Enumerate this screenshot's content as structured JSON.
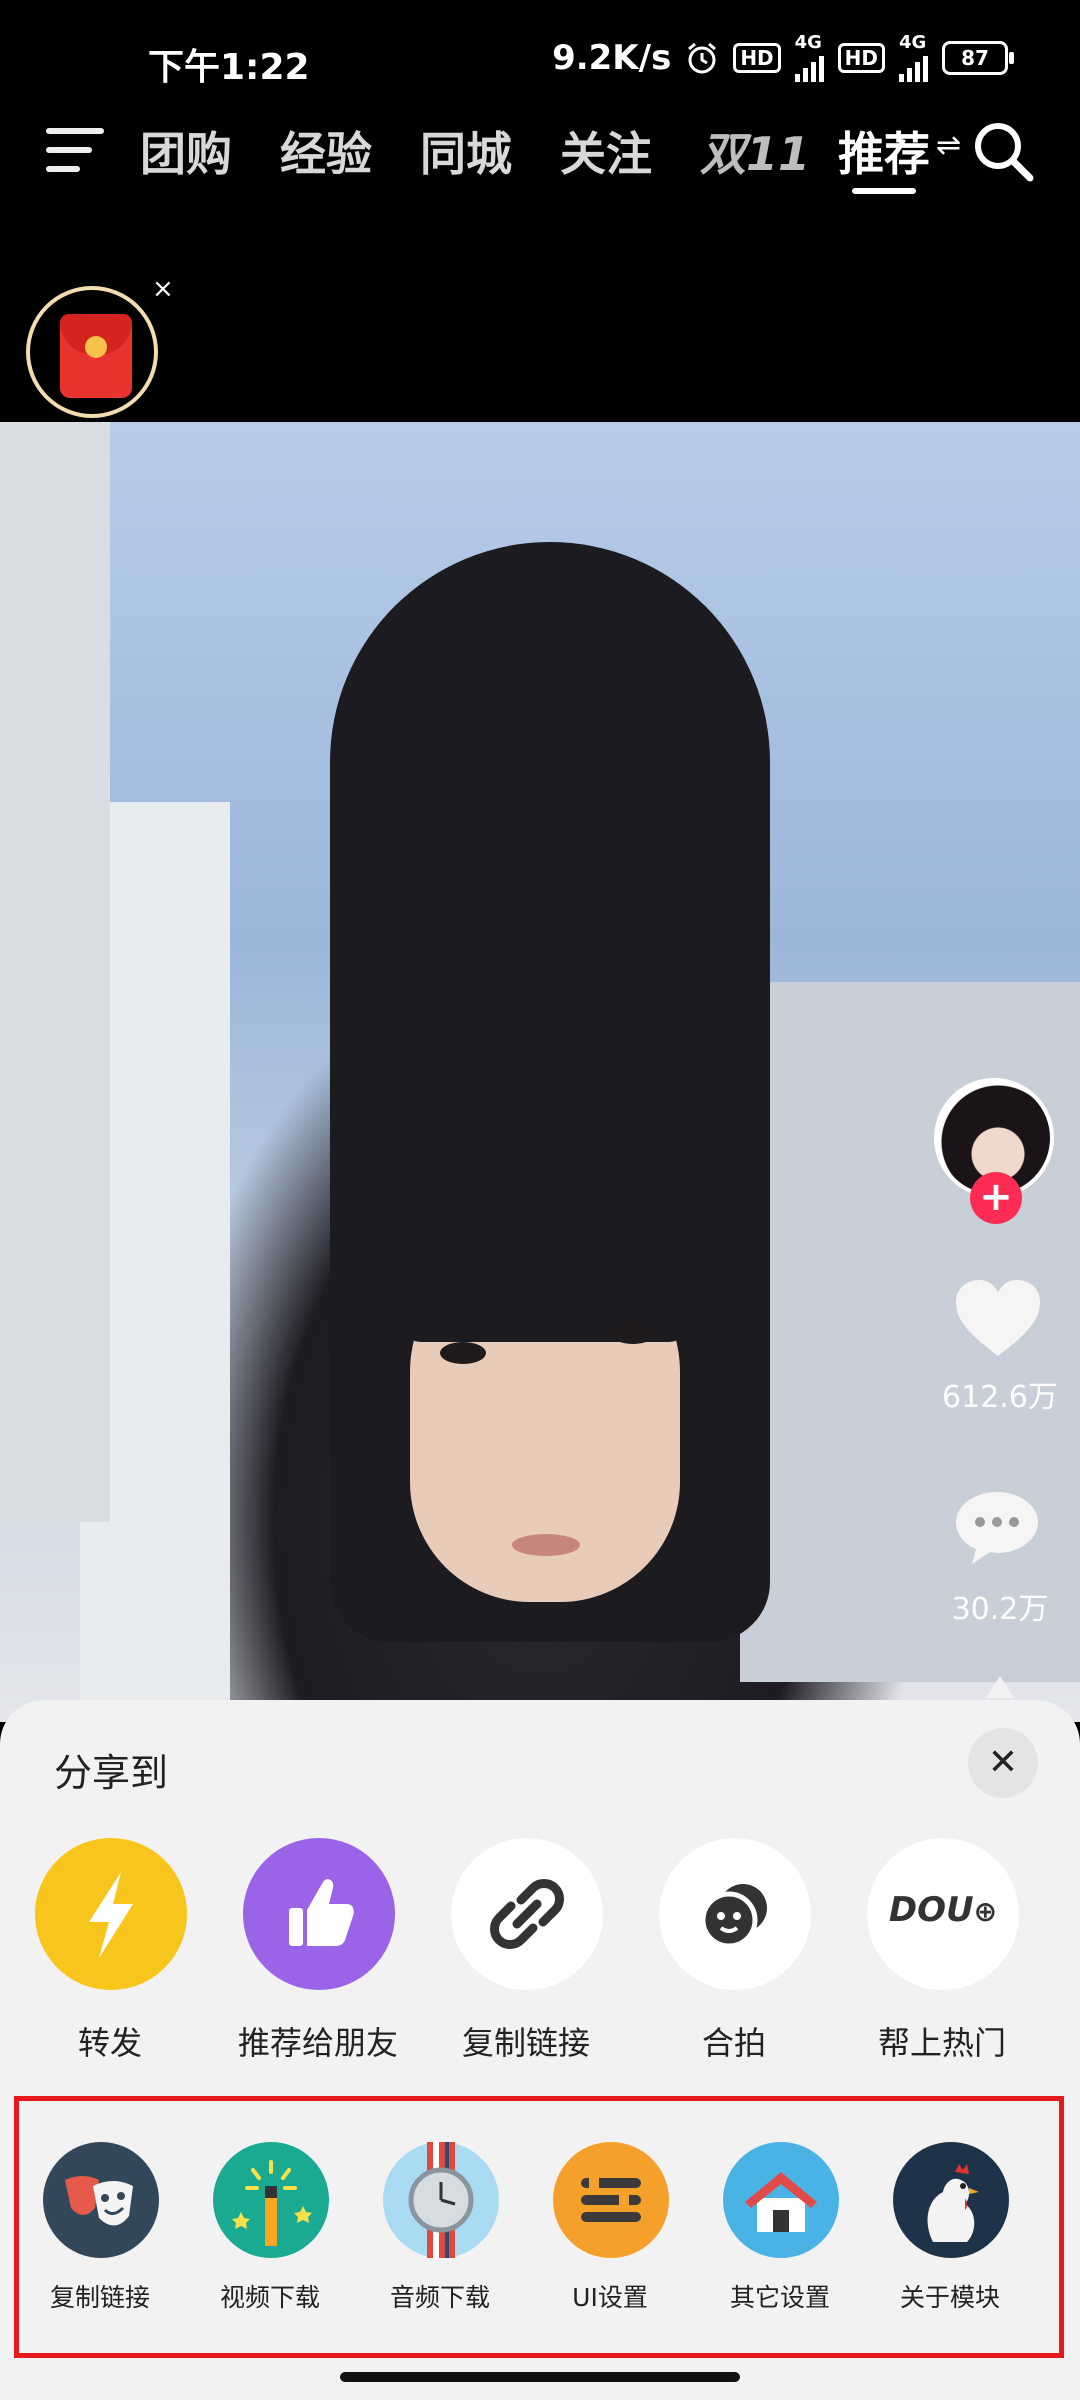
{
  "status_bar": {
    "time": "下午1:22",
    "speed": "9.2K/s",
    "hd1": "HD",
    "sig1": "4G",
    "hd2": "HD",
    "sig2": "4G",
    "battery": "87"
  },
  "top_nav": {
    "tabs": [
      "团购",
      "经验",
      "同城",
      "关注",
      "双11",
      "推荐"
    ],
    "active_tab": "推荐",
    "switch_glyph": "⇌"
  },
  "red_packet": {
    "close": "×"
  },
  "right_rail": {
    "like_count": "612.6万",
    "comment_count": "30.2万",
    "follow_plus": "+"
  },
  "share_sheet": {
    "title": "分享到",
    "close": "✕",
    "items": [
      {
        "label": "转发",
        "icon": "lightning-icon",
        "color": "#f7c51b"
      },
      {
        "label": "推荐给朋友",
        "icon": "thumbs-up-icon",
        "color": "#9b63e8"
      },
      {
        "label": "复制链接",
        "icon": "link-icon",
        "color": "#ffffff"
      },
      {
        "label": "合拍",
        "icon": "duet-icon",
        "color": "#ffffff"
      },
      {
        "label": "帮上热门",
        "icon": "dou-plus-icon",
        "color": "#ffffff",
        "badge_text": "DOU"
      }
    ]
  },
  "module_row": {
    "items": [
      {
        "label": "复制链接",
        "icon": "theater-masks-icon",
        "color": "#33475b"
      },
      {
        "label": "视频下载",
        "icon": "magic-wand-icon",
        "color": "#1aaa92"
      },
      {
        "label": "音频下载",
        "icon": "watch-icon",
        "color": "#a9dbf2"
      },
      {
        "label": "UI设置",
        "icon": "settings-bars-icon",
        "color": "#f5a02a"
      },
      {
        "label": "其它设置",
        "icon": "house-icon",
        "color": "#4ab3e6"
      },
      {
        "label": "关于模块",
        "icon": "rooster-icon",
        "color": "#1e3249"
      }
    ]
  }
}
